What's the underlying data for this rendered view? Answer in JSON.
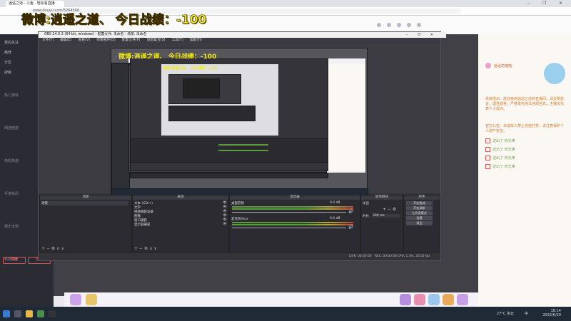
{
  "browser": {
    "tab_title": "逍遥之道 - 斗鱼 · 轻松看直播",
    "url": "www.douyu.com/5264568",
    "window_controls": "– ❐ ✕"
  },
  "overlay": {
    "title": "微博:逍遥之道、   今日战绩：-100"
  },
  "nested": {
    "title_small": "微博:逍遥之道、  今日战绩：-100",
    "title_tiny": "微博:逍遥之道、  今日战绩：-100"
  },
  "sidebar": {
    "items": [
      "我的关注",
      "推荐",
      "分区",
      "搜索"
    ],
    "sections": [
      "热门游戏",
      "网游竞技",
      "单机热游",
      "手游休闲",
      "娱乐天地",
      "科技文化"
    ],
    "buttons": [
      "开播",
      "登录"
    ]
  },
  "obs": {
    "title": "OBS 24.0.3 (64-bit, windows) - 配置文件: 未命名 - 场景: 未命名",
    "menu": [
      "文件(F)",
      "编辑(E)",
      "查看(V)",
      "停靠部件(D)",
      "配置文件(P)",
      "场景集合(S)",
      "工具(T)",
      "帮助(H)"
    ],
    "docks": {
      "scenes": {
        "header": "场景",
        "items": [
          "场景"
        ]
      },
      "sources": {
        "header": "来源",
        "items": [
          "文本 (GDI+)",
          "文字",
          "视频捕获设备",
          "图像",
          "窗口捕获",
          "显示器捕获"
        ]
      },
      "mixer": {
        "header": "混音器",
        "channels": [
          {
            "name": "桌面音频",
            "level_db": "0.0 dB"
          },
          {
            "name": "麦克风/Aux",
            "level_db": "0.0 dB"
          }
        ]
      },
      "transitions": {
        "header": "转场特效",
        "type": "淡出",
        "duration_label": "时长",
        "duration": "300 ms"
      },
      "controls": {
        "header": "控件",
        "buttons": [
          "开始推流",
          "开始录制",
          "工作室模式",
          "设置",
          "退出"
        ]
      }
    },
    "status": {
      "live": "LIVE: 00:00:00",
      "rec": "REC: 00:00:00",
      "cpu": "CPU: 1.3%, 30.00 fps"
    },
    "toolbar_icons": "+ − ⚙ ∧ ∨"
  },
  "chat": {
    "anchor": "逍遥的喵喵",
    "messages": [
      "系统提示：欢迎来到逍遥之道的直播间，请文明发言，理性观看，严禁发布违法违规信息，主播仅代表个人观点。",
      "官方公告：未成年人禁止充值打赏，请注意保护个人财产安全。"
    ],
    "gift_rows": [
      "送出了 荧光棒",
      "送出了 荧光棒",
      "送出了 荧光棒",
      "送出了 荧光棒"
    ]
  },
  "taskbar": {
    "time": "18:14",
    "date": "2022/6/20",
    "weather": "27°C 多云",
    "lang": "中"
  },
  "colors": {
    "overlay_yellow": "#f1ea17",
    "obs_bg": "#333338",
    "taskbar": "#1f2a36"
  }
}
